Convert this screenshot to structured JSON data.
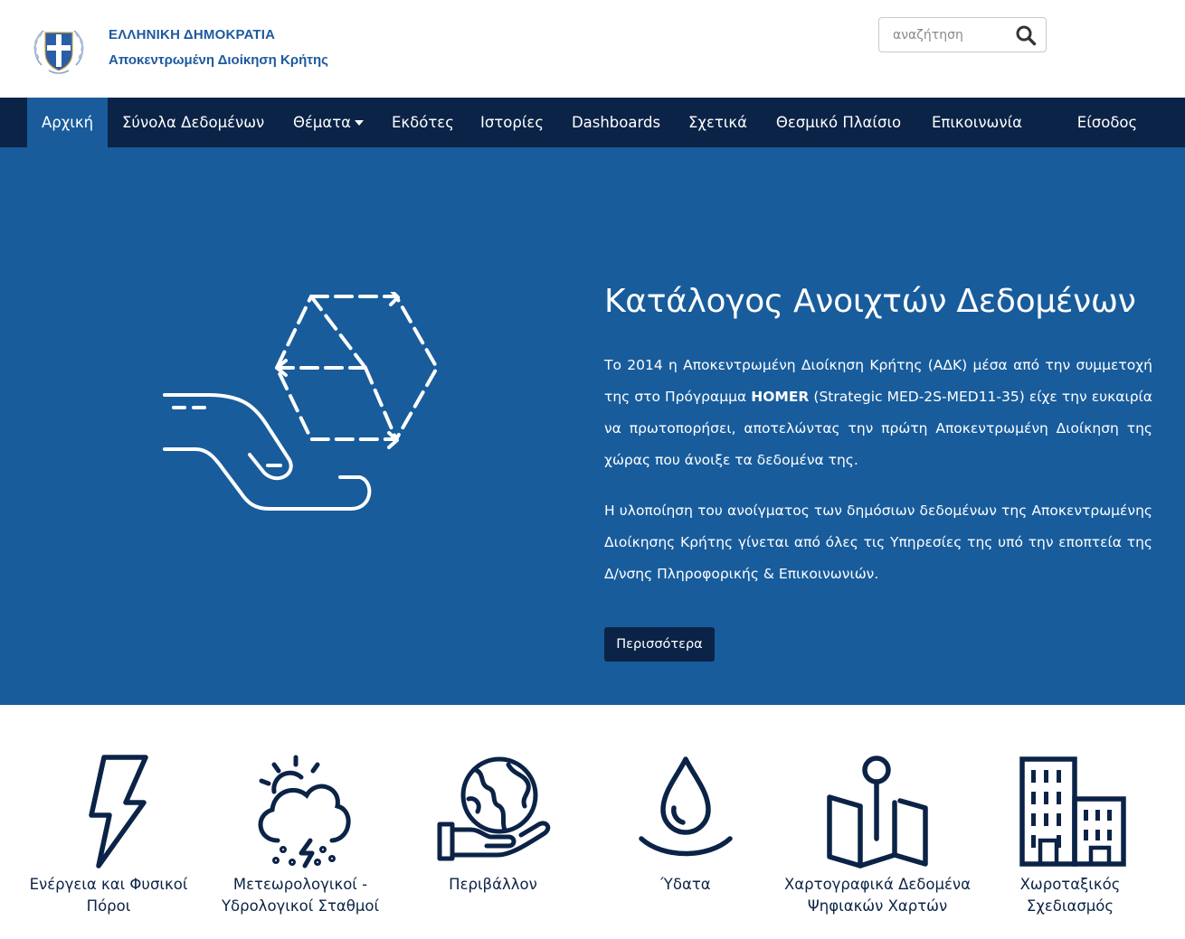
{
  "header": {
    "org_line1": "ΕΛΛΗΝΙΚΗ ΔΗΜΟΚΡΑΤΙΑ",
    "org_line2": "Αποκεντρωμένη Διοίκηση Κρήτης",
    "search_placeholder": "αναζήτηση",
    "emblem_icon": "greek-coat-of-arms-icon",
    "search_icon": "search-icon"
  },
  "nav": {
    "items": [
      {
        "label": "Αρχική",
        "active": true
      },
      {
        "label": "Σύνολα Δεδομένων"
      },
      {
        "label": "Θέματα",
        "dropdown": true
      },
      {
        "label": "Εκδότες"
      },
      {
        "label": "Ιστορίες"
      },
      {
        "label": "Dashboards"
      },
      {
        "label": "Σχετικά"
      },
      {
        "label": "Θεσμικό Πλαίσιο"
      },
      {
        "label": "Επικοινωνία"
      },
      {
        "label": "Είσοδος"
      }
    ]
  },
  "hero": {
    "title": "Κατάλογος Ανοιχτών Δεδομένων",
    "para1_pre": "Το 2014 η Αποκεντρωμένη Διοίκηση Κρήτης (ΑΔΚ) μέσα από την συμμετοχή της στο Πρόγραμμα ",
    "para1_bold": "HOMER",
    "para1_post": " (Strategic MED-2S-MED11-35) είχε την ευκαιρία να πρωτοπορήσει, αποτελώντας την πρώτη Αποκεντρωμένη Διοίκηση της χώρας που άνοιξε τα δεδομένα της.",
    "para2": "Η υλοποίηση του ανοίγματος των δημόσιων δεδομένων της Αποκεντρωμένης Διοίκησης Κρήτης γίνεται από όλες τις Υπηρεσίες της υπό την εποπτεία της Δ/νσης Πληροφορικής & Επικοινωνιών.",
    "button_label": "Περισσότερα",
    "illustration_icon": "hand-holding-cube-icon"
  },
  "colors": {
    "navy": "#0b2346",
    "hero_blue": "#185c9c",
    "active_tab": "#1a5c9b",
    "org_text": "#1e5aa0"
  },
  "categories": [
    {
      "label": "Ενέργεια και Φυσικοί Πόροι",
      "icon": "lightning-bolt-icon"
    },
    {
      "label": "Μετεωρολογικοί - Υδρολογικοί Σταθμοί",
      "icon": "storm-cloud-sun-icon"
    },
    {
      "label": "Περιβάλλον",
      "icon": "hand-holding-globe-icon"
    },
    {
      "label": "Ύδατα",
      "icon": "water-drop-icon"
    },
    {
      "label": "Χαρτογραφικά Δεδομένα Ψηφιακών Χαρτών",
      "icon": "map-pin-icon"
    },
    {
      "label": "Χωροταξικός Σχεδιασμός",
      "icon": "buildings-icon"
    }
  ]
}
